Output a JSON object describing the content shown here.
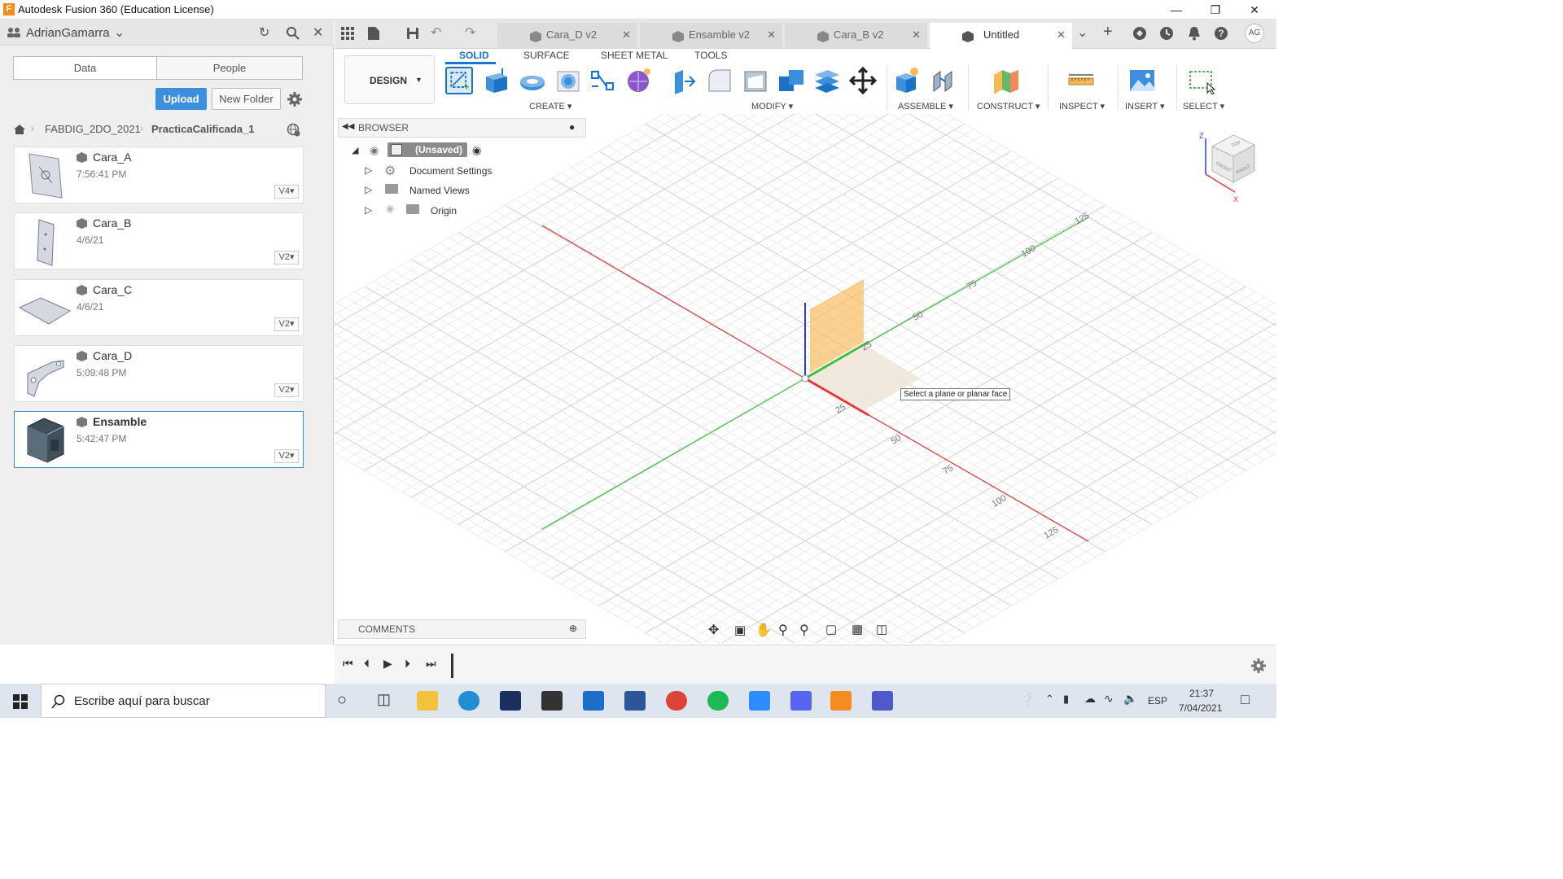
{
  "window": {
    "title": "Autodesk Fusion 360 (Education License)",
    "app_icon_letter": "F",
    "controls": {
      "minimize": "—",
      "maximize": "❐",
      "close": "✕"
    }
  },
  "left_panel": {
    "user": "AdrianGamarra",
    "segments": {
      "data": "Data",
      "people": "People"
    },
    "upload_label": "Upload",
    "new_folder_label": "New Folder",
    "breadcrumb": {
      "project": "FABDIG_2DO_2021",
      "folder": "PracticaCalificada_1"
    },
    "files": [
      {
        "name": "Cara_A",
        "date": "7:56:41 PM",
        "version": "V4"
      },
      {
        "name": "Cara_B",
        "date": "4/6/21",
        "version": "V2"
      },
      {
        "name": "Cara_C",
        "date": "4/6/21",
        "version": "V2"
      },
      {
        "name": "Cara_D",
        "date": "5:09:48 PM",
        "version": "V2"
      },
      {
        "name": "Ensamble",
        "date": "5:42:47 PM",
        "version": "V2"
      }
    ]
  },
  "tabs": [
    {
      "label": "Cara_D v2"
    },
    {
      "label": "Ensamble v2"
    },
    {
      "label": "Cara_B v2"
    },
    {
      "label": "Untitled"
    }
  ],
  "toolbar": {
    "workspace": "DESIGN",
    "ribbon_tabs": [
      "SOLID",
      "SURFACE",
      "SHEET METAL",
      "TOOLS"
    ],
    "groups": [
      "CREATE",
      "MODIFY",
      "ASSEMBLE",
      "CONSTRUCT",
      "INSPECT",
      "INSERT",
      "SELECT"
    ],
    "user_initials": "AG"
  },
  "browser": {
    "title": "BROWSER",
    "root": "(Unsaved)",
    "nodes": [
      "Document Settings",
      "Named Views",
      "Origin"
    ]
  },
  "viewport": {
    "tooltip": "Select a plane or planar face",
    "grid_labels_green": [
      "125",
      "100",
      "75",
      "50",
      "25"
    ],
    "grid_labels_red": [
      "25",
      "50",
      "75",
      "100",
      "125"
    ],
    "viewcube": {
      "top": "TOP",
      "front": "FRONT",
      "right": "RIGHT",
      "z": "Z",
      "x": "X"
    }
  },
  "comments": {
    "title": "COMMENTS"
  },
  "taskbar": {
    "search_placeholder": "Escribe aquí para buscar",
    "language": "ESP",
    "time": "21:37",
    "date": "7/04/2021"
  },
  "colors": {
    "accent": "#1a73c9",
    "upload": "#3c8fde",
    "plane": "#f7b955",
    "x_axis": "#e23b3b",
    "y_axis": "#3fbf3f",
    "z_axis": "#2b3fd0"
  }
}
